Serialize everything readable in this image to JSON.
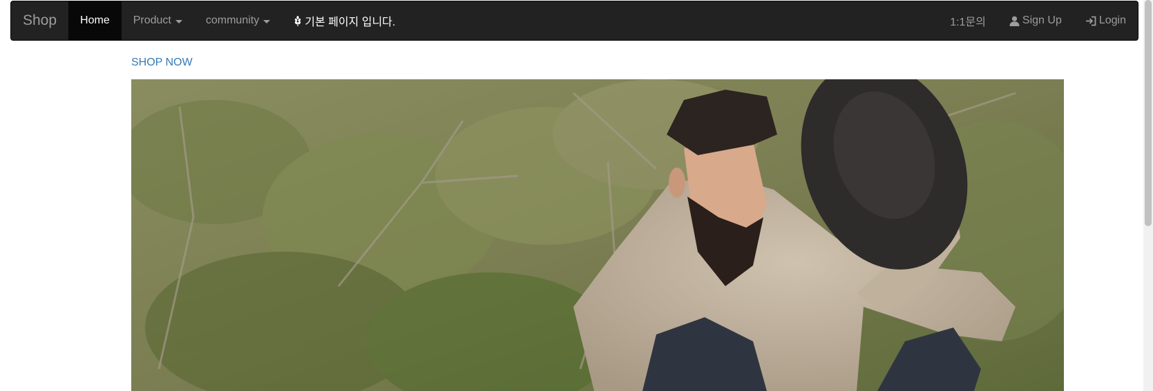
{
  "navbar": {
    "brand": "Shop",
    "items": [
      {
        "label": "Home",
        "active": true
      },
      {
        "label": "Product",
        "dropdown": true
      },
      {
        "label": "community",
        "dropdown": true
      },
      {
        "label": "기본 페이지 입니다.",
        "icon": "grain-icon"
      }
    ],
    "right_items": [
      {
        "label": "1:1문의"
      },
      {
        "label": "Sign Up",
        "icon": "user-icon"
      },
      {
        "label": "Login",
        "icon": "login-icon"
      }
    ]
  },
  "shop_now": "SHOP NOW",
  "hero": {
    "description": "Bearded man in knit sweater holding a dark hat in desert brush"
  },
  "colors": {
    "navbar_bg": "#222222",
    "active_bg": "#080808",
    "muted_text": "#9d9d9d",
    "link": "#337ab7"
  }
}
